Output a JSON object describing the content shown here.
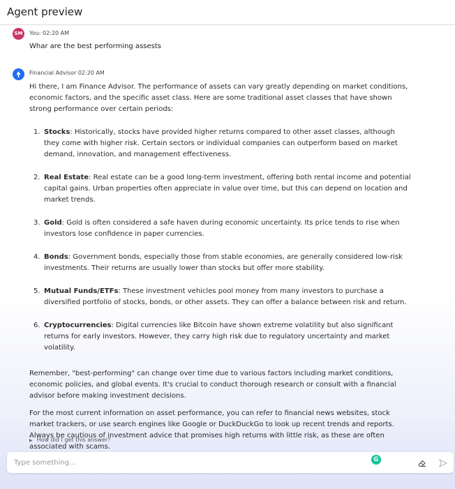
{
  "header": {
    "title": "Agent preview"
  },
  "user_message": {
    "avatar_initials": "SM",
    "meta": "You: 02:20 AM",
    "text": "Whar are the best performing assests"
  },
  "bot_message": {
    "meta": "Financial Advisor 02:20 AM",
    "intro": "Hi there, I am Finance Advisor. The performance of assets can vary greatly depending on market conditions, economic factors, and the specific asset class. Here are some traditional asset classes that have shown strong performance over certain periods:",
    "items": [
      {
        "num": "1.",
        "title": "Stocks",
        "text": ": Historically, stocks have provided higher returns compared to other asset classes, although they come with higher risk. Certain sectors or individual companies can outperform based on market demand, innovation, and management effectiveness."
      },
      {
        "num": "2.",
        "title": "Real Estate",
        "text": ": Real estate can be a good long-term investment, offering both rental income and potential capital gains. Urban properties often appreciate in value over time, but this can depend on location and market trends."
      },
      {
        "num": "3.",
        "title": "Gold",
        "text": ": Gold is often considered a safe haven during economic uncertainty. Its price tends to rise when investors lose confidence in paper currencies."
      },
      {
        "num": "4.",
        "title": "Bonds",
        "text": ": Government bonds, especially those from stable economies, are generally considered low-risk investments. Their returns are usually lower than stocks but offer more stability."
      },
      {
        "num": "5.",
        "title": "Mutual Funds/ETFs",
        "text": ": These investment vehicles pool money from many investors to purchase a diversified portfolio of stocks, bonds, or other assets. They can offer a balance between risk and return."
      },
      {
        "num": "6.",
        "title": "Cryptocurrencies",
        "text": ": Digital currencies like Bitcoin have shown extreme volatility but also significant returns for early investors. However, they carry high risk due to regulatory uncertainty and market volatility."
      }
    ],
    "remember": "Remember, \"best-performing\" can change over time due to various factors including market conditions, economic policies, and global events. It's crucial to conduct thorough research or consult with a financial advisor before making investment decisions.",
    "closing": "For the most current information on asset performance, you can refer to financial news websites, stock market trackers, or use search engines like Google or DuckDuckGo to look up recent trends and reports. Always be cautious of investment advice that promises high returns with little risk, as these are often associated with scams.",
    "how_link": "How did I get this answer?"
  },
  "composer": {
    "placeholder": "Type something...",
    "grammarly_glyph": "G",
    "icons": {
      "eraser": "eraser-icon",
      "send": "send-icon",
      "avatar_bot": "advisor-avatar-icon"
    }
  },
  "colors": {
    "user_avatar": "#c9356b",
    "bot_avatar": "#1e6ff1",
    "grammarly": "#15c39a"
  }
}
